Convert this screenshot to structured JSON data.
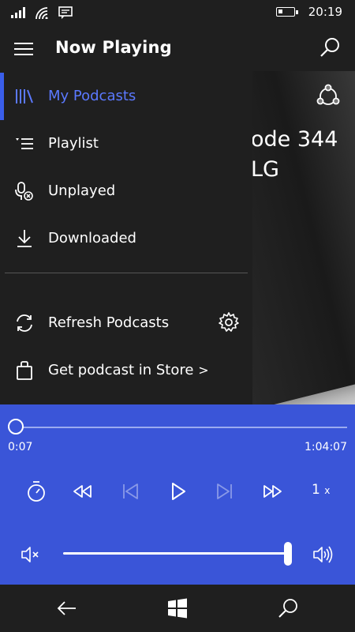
{
  "status_bar": {
    "time": "20:19"
  },
  "header": {
    "title": "Now Playing"
  },
  "artwork": {
    "text_line1": "ode 344",
    "text_line2": "LG"
  },
  "drawer": {
    "items": [
      {
        "label": "My Podcasts",
        "icon": "library-icon",
        "active": true
      },
      {
        "label": "Playlist",
        "icon": "playlist-icon",
        "active": false
      },
      {
        "label": "Unplayed",
        "icon": "unplayed-icon",
        "active": false
      },
      {
        "label": "Downloaded",
        "icon": "download-icon",
        "active": false
      }
    ],
    "footer": [
      {
        "label": "Refresh Podcasts",
        "icon": "refresh-icon"
      },
      {
        "label": "Get podcast in Store",
        "icon": "store-bag-icon",
        "chevron": ">"
      }
    ]
  },
  "player": {
    "current_time": "0:07",
    "total_time": "1:04:07",
    "progress": 0.002,
    "speed_value": "1",
    "speed_unit": "x",
    "volume": 0.98,
    "accent_color": "#3a55d8"
  }
}
